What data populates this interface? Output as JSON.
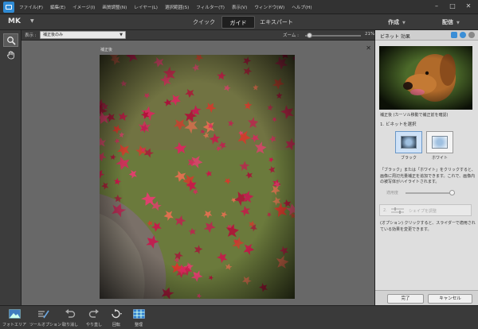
{
  "menubar": {
    "items": [
      "ファイル(F)",
      "編集(E)",
      "イメージ(I)",
      "画質調整(N)",
      "レイヤー(L)",
      "選択範囲(S)",
      "フィルター(T)",
      "表示(V)",
      "ウィンドウ(W)",
      "ヘルプ(H)"
    ]
  },
  "window": {
    "minimize": "–",
    "maximize": "□",
    "close": "✕"
  },
  "modebar": {
    "mk_label": "MK",
    "tabs": [
      "クイック",
      "ガイド",
      "エキスパート"
    ],
    "active_tab": "ガイド",
    "create": "作成",
    "share": "配信"
  },
  "options": {
    "view_label": "表示 :",
    "view_value": "補正後のみ",
    "zoom_label": "ズーム :",
    "zoom_value": "21%",
    "zoom_fraction": 0.08
  },
  "canvas": {
    "doc_title": "補正後",
    "close": "✕"
  },
  "panel": {
    "title": "ビネット 効果",
    "preview_caption": "補正後 (カーソル移動で補正前を確認)",
    "step1": "1. ビネットを選択",
    "thumbs": [
      "ブラック",
      "ホワイト"
    ],
    "selected_thumb": "ブラック",
    "help_text": "「ブラック」または「ホワイト」をクリックすると、画像に周辺光量補正を追加できます。これで、画像内の被写体がハイライトされます。",
    "amount_label": "適用度",
    "amount_fraction": 0.95,
    "step2_num": "2.",
    "step2_label": "シェイプを調整",
    "optional_text": "(オプション) クリックすると、スライダーで適用されている効果を変更できます。",
    "done_button": "完了",
    "cancel_button": "キャンセル"
  },
  "bottombar": {
    "items": [
      "フォトエリア",
      "ツールオプション",
      "取り消し",
      "やり直し",
      "回転",
      "整理"
    ]
  },
  "colors": {
    "accent": "#2f8bd4",
    "panel_bg": "#dedede",
    "canvas_bg": "#686868"
  }
}
